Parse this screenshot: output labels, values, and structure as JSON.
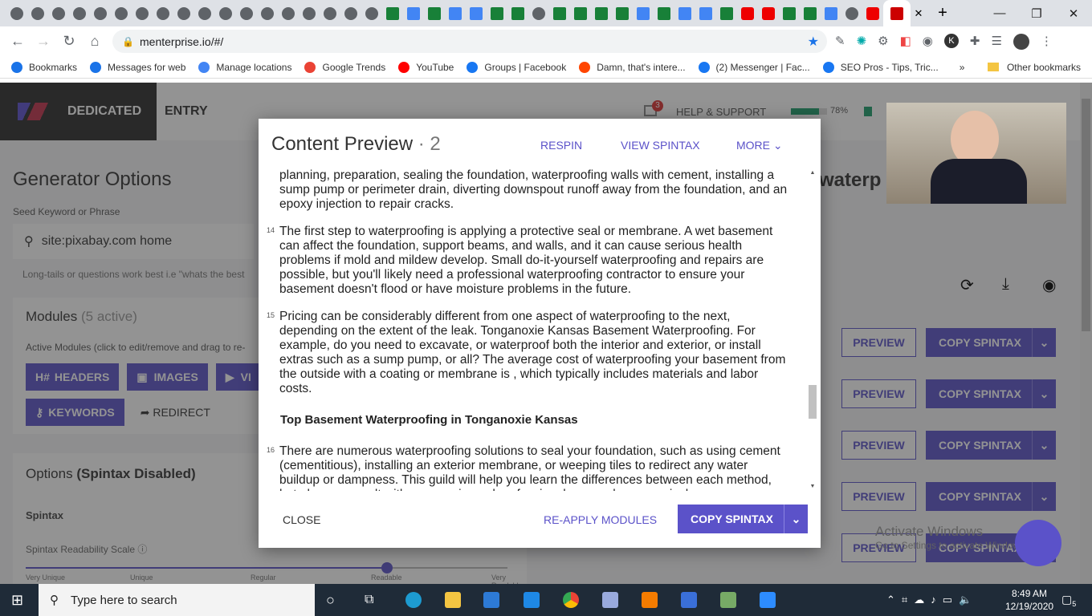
{
  "browser": {
    "url": "menterprise.io/#/",
    "bookmarks": [
      {
        "label": "Bookmarks",
        "color": "#1a73e8"
      },
      {
        "label": "Messages for web",
        "color": "#1a73e8"
      },
      {
        "label": "Manage locations",
        "color": "#4285f4"
      },
      {
        "label": "Google Trends",
        "color": "#ea4335"
      },
      {
        "label": "YouTube",
        "color": "#ff0000"
      },
      {
        "label": "Groups | Facebook",
        "color": "#1877f2"
      },
      {
        "label": "Damn, that's intere...",
        "color": "#ff4500"
      },
      {
        "label": "(2) Messenger | Fac...",
        "color": "#1877f2"
      },
      {
        "label": "SEO Pros - Tips, Tric...",
        "color": "#1877f2"
      }
    ],
    "more": "»",
    "other_bookmarks": "Other bookmarks"
  },
  "app": {
    "brand": "DEDICATED",
    "section": "ENTRY",
    "notifications": "3",
    "help": "HELP & SUPPORT",
    "progress_pct": 78,
    "progress_label": "78%",
    "accent": "#5b52c9"
  },
  "left": {
    "title": "Generator Options",
    "seed_label": "Seed Keyword or Phrase",
    "seed_value": "site:pixabay.com home",
    "hint": "Long-tails or questions work best i.e \"whats the best",
    "modules_title": "Modules",
    "modules_count": "(5 active)",
    "modules_hint": "Active Modules (click to edit/remove and drag to re-",
    "chips": [
      "HEADERS",
      "IMAGES",
      "VI",
      "KEYWORDS"
    ],
    "redirect": "REDIRECT",
    "options_title": "Options",
    "options_bold": "(Spintax Disabled)",
    "spintax": "Spintax",
    "scale_label": "Spintax Readability Scale",
    "scale_ticks": [
      "Very Unique",
      "Unique",
      "Regular",
      "Readable",
      "Very Readable"
    ],
    "scale_value": "Readable"
  },
  "right": {
    "heading_fragment": "waterp",
    "preview": "PREVIEW",
    "copy": "COPY SPINTAX",
    "watermark1": "Activate Windows",
    "watermark2": "Go to Settings to activate Windows."
  },
  "modal": {
    "title": "Content Preview",
    "count": "· 2",
    "respin": "RESPIN",
    "view_spintax": "VIEW SPINTAX",
    "more": "MORE",
    "paragraphs": [
      {
        "num": "",
        "text": "planning, preparation, sealing the foundation, waterproofing walls with cement, installing a sump pump or perimeter drain, diverting downspout runoff away from the foundation, and an epoxy injection to repair cracks."
      },
      {
        "num": "14",
        "text": "The first step to waterproofing is applying a protective seal or membrane. A wet basement can affect the foundation, support beams, and walls, and it can cause serious health problems if mold and mildew develop. Small do-it-yourself waterproofing and repairs are possible, but you'll likely need a professional waterproofing contractor to ensure your basement doesn't flood or have moisture problems in the future."
      },
      {
        "num": "15",
        "text": "Pricing can be considerably different from one aspect of waterproofing to the next, depending on the extent of the leak. Tonganoxie Kansas Basement Waterproofing. For example, do you need to excavate, or waterproof both the interior and exterior, or install extras such as a sump pump, or all? The average cost of waterproofing your basement from the outside with a coating or membrane is , which typically includes materials and labor costs."
      }
    ],
    "subheading": "Top Basement Waterproofing in Tonganoxie Kansas",
    "paragraph16": {
      "num": "16",
      "text": "There are numerous waterproofing solutions to seal your foundation, such as using cement (cementitious), installing an exterior membrane, or weeping tiles to redirect any water buildup or dampness. This guild will help you learn the differences between each method, but always consult with an experienced professional, so you know precisely"
    },
    "close": "CLOSE",
    "reapply": "RE-APPLY MODULES",
    "copy": "COPY SPINTAX"
  },
  "taskbar": {
    "search_placeholder": "Type here to search",
    "time": "8:49 AM",
    "date": "12/19/2020",
    "notif_count": "5"
  }
}
